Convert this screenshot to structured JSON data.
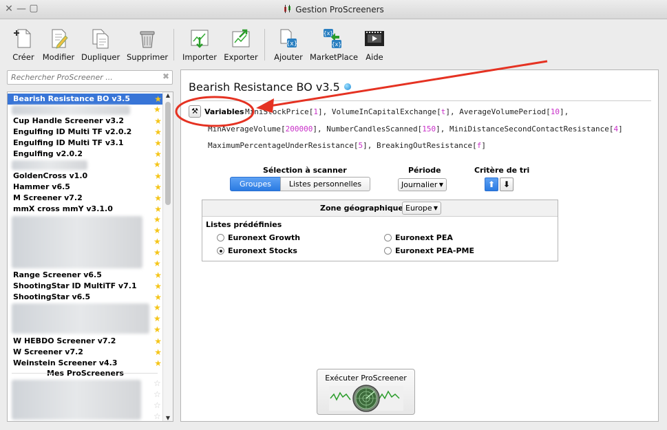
{
  "window": {
    "title": "Gestion ProScreeners"
  },
  "toolbar": {
    "buttons": [
      {
        "label": "Créer",
        "icon": "new-document-icon"
      },
      {
        "label": "Modifier",
        "icon": "edit-document-icon"
      },
      {
        "label": "Dupliquer",
        "icon": "duplicate-icon"
      },
      {
        "label": "Supprimer",
        "icon": "trash-icon"
      },
      {
        "label": "Importer",
        "icon": "import-icon"
      },
      {
        "label": "Exporter",
        "icon": "export-icon"
      },
      {
        "label": "Ajouter",
        "icon": "add-code-icon"
      },
      {
        "label": "MarketPlace",
        "icon": "marketplace-icon"
      },
      {
        "label": "Aide",
        "icon": "help-video-icon"
      }
    ]
  },
  "sidebar": {
    "search_placeholder": "Rechercher ProScreener ...",
    "items": [
      {
        "label": "Bearish Resistance BO v3.5",
        "selected": true
      },
      {
        "label": "Cup Handle Screener v3.2"
      },
      {
        "label": "Engulfing ID Multi TF v2.0.2"
      },
      {
        "label": "Engulfing ID Multi TF v3.1"
      },
      {
        "label": "Engulfing v2.0.2"
      },
      {
        "label": "GoldenCross v1.0"
      },
      {
        "label": "Hammer v6.5"
      },
      {
        "label": "M Screener v7.2"
      },
      {
        "label": "mmX cross mmY v3.1.0"
      },
      {
        "label": "Range Screener v6.5"
      },
      {
        "label": "ShootingStar ID MultiTF v7.1"
      },
      {
        "label": "ShootingStar v6.5"
      },
      {
        "label": "W HEBDO Screener v7.2"
      },
      {
        "label": "W Screener v7.2"
      },
      {
        "label": "Weinstein Screener v4.3"
      }
    ],
    "section_my": "Mes ProScreeners"
  },
  "main": {
    "title": "Bearish Resistance BO v3.5",
    "variables_label": "Variables",
    "variables": [
      {
        "name": "MiniStockPrice",
        "value": "1"
      },
      {
        "name": "VolumeInCapitalExchange",
        "value": "t"
      },
      {
        "name": "AverageVolumePeriod",
        "value": "10"
      },
      {
        "name": "MinAverageVolume",
        "value": "200000"
      },
      {
        "name": "NumberCandlesScanned",
        "value": "150"
      },
      {
        "name": "MiniDistanceSecondContactResistance",
        "value": "4"
      },
      {
        "name": "MaximumPercentageUnderResistance",
        "value": "5"
      },
      {
        "name": "BreakingOutResistance",
        "value": "f"
      }
    ],
    "selection_label": "Sélection à scanner",
    "selection_tabs": [
      "Groupes",
      "Listes personnelles"
    ],
    "period_label": "Période",
    "period_value": "Journalier",
    "sort_label": "Critère de tri",
    "zone_label": "Zone géographique :",
    "zone_value": "Europe",
    "lists_label": "Listes prédéfinies",
    "lists": [
      {
        "label": "Euronext Growth",
        "checked": false
      },
      {
        "label": "Euronext PEA",
        "checked": false
      },
      {
        "label": "Euronext Stocks",
        "checked": true
      },
      {
        "label": "Euronext PEA-PME",
        "checked": false
      }
    ],
    "run_label": "Exécuter ProScreener"
  },
  "colors": {
    "selection": "#3875d7",
    "accent": "#2a7ae2",
    "variable_value": "#c82fc8",
    "annotation": "#e53222",
    "star": "#f5c518"
  }
}
